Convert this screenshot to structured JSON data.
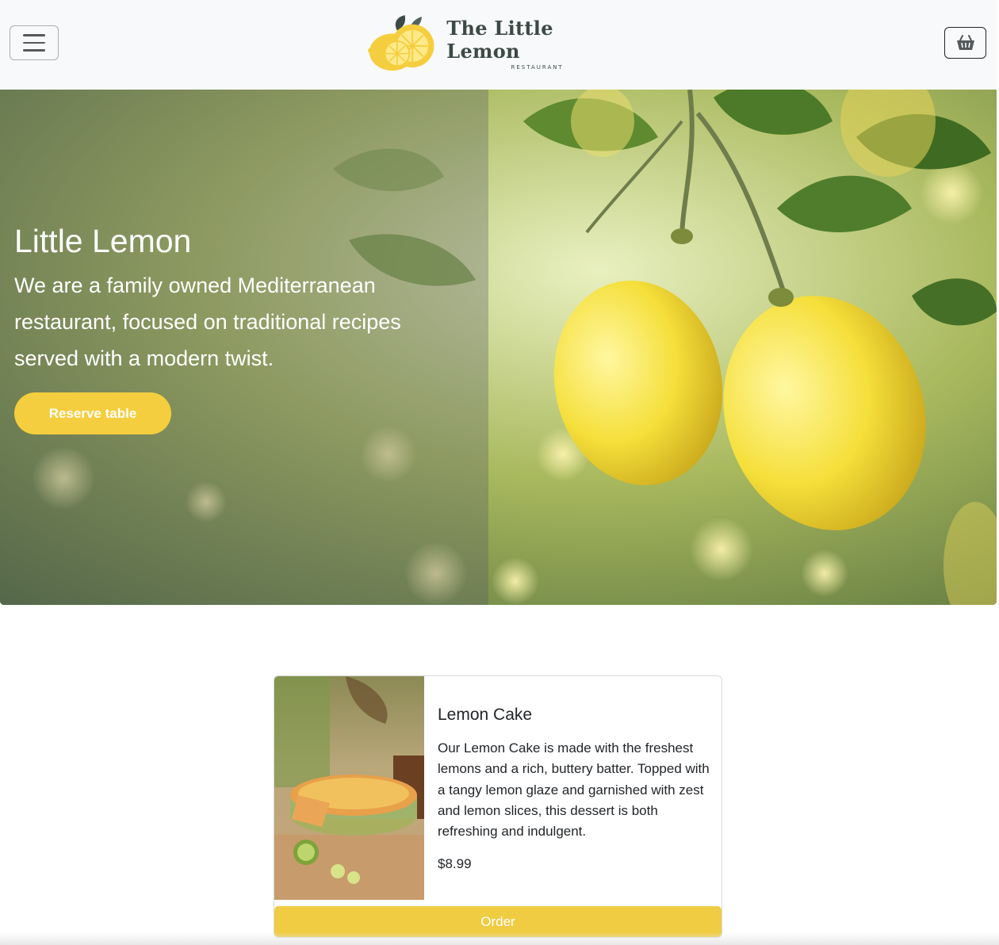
{
  "header": {
    "brand_title": "The Little Lemon",
    "brand_subtitle": "RESTAURANT",
    "menu_icon": "hamburger-menu-icon",
    "cart_icon": "basket-icon"
  },
  "hero": {
    "title": "Little Lemon",
    "description": "We are a family owned Mediterranean restaurant, focused on traditional recipes served with a modern twist.",
    "reserve_label": "Reserve table"
  },
  "featured": {
    "title": "Lemon Cake",
    "description": "Our Lemon Cake is made with the freshest lemons and a rich, buttery batter. Topped with a tangy lemon glaze and garnished with zest and lemon slices, this dessert is both refreshing and indulgent.",
    "price": "$8.99",
    "order_label": "Order"
  },
  "colors": {
    "accent": "#F4CE3E",
    "brand_dark": "#3C4A45",
    "navbar_bg": "#F8F9FA"
  }
}
